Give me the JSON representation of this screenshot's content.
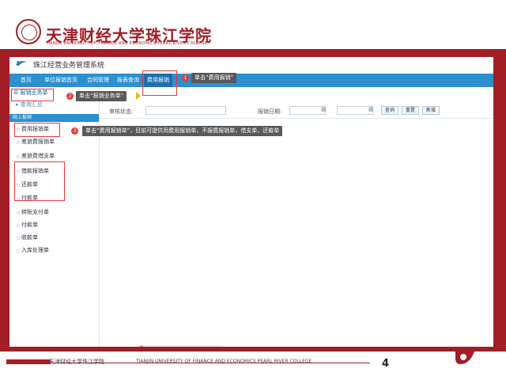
{
  "header": {
    "school_name_cn": "天津财经大学珠江学院",
    "school_name_en": "TIANJIN UNIVERSITY OF FINANCE AND ECONOMICS PEARL RIVER COLLEGE"
  },
  "app": {
    "title": "珠江经营业务管理系统",
    "nav": [
      "首页",
      "单位报销首页",
      "合同管理",
      "报表查询",
      "费用报销"
    ],
    "active_nav": "费用报销"
  },
  "sidebar": {
    "header": "报销业务单",
    "subheader": "查询汇总",
    "category": "网上报销",
    "items": [
      "费用报销单",
      "差旅费报销单",
      "差旅费借支单",
      "借款报销单",
      "还款单",
      "付款单",
      "转账支付单",
      "付款单",
      "收款单",
      "入库处理单"
    ]
  },
  "filters": {
    "label_1": "审核状态:",
    "label_2": "报销日期:",
    "buttons": [
      "查询",
      "重置",
      "新增"
    ]
  },
  "annotations": [
    {
      "num": "1",
      "text": "单击“费用报销”"
    },
    {
      "num": "2",
      "text": "单击“报销业务单”"
    },
    {
      "num": "3",
      "text": "单击“费用报销单”，目前可提供用费用报销单，不报费报销单，借支单，还款单"
    }
  ],
  "footer": {
    "left_text": "天津财经大学珠江学院",
    "english": "TIANJIN UNIVERSITY OF FINANCE AND ECONOMICS PEARL RIVER COLLEGE",
    "page_number": "4"
  },
  "colors": {
    "brand_red": "#a31d24",
    "nav_blue": "#2b8fd0",
    "highlight_red": "#e53b3b",
    "tooltip_gray": "#595959"
  }
}
